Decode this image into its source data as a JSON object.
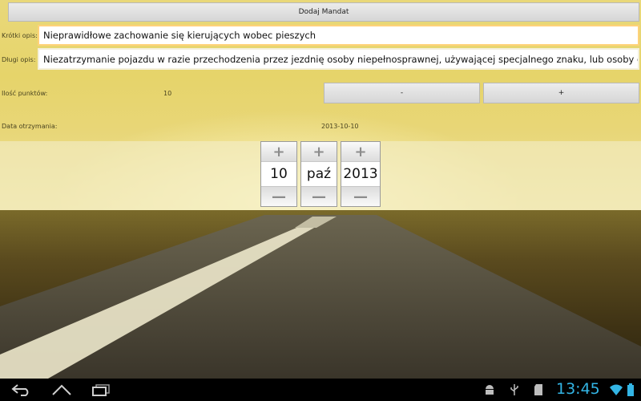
{
  "header": {
    "add_ticket_label": "Dodaj Mandat"
  },
  "form": {
    "short_desc_label": "Krótki opis:",
    "short_desc_value": "Nieprawidłowe zachowanie się kierujących wobec pieszych",
    "long_desc_label": "Długi opis:",
    "long_desc_value": "Niezatrzymanie pojazdu w razie przechodzenia przez jezdnię osoby niepełnosprawnej, używającej specjalnego znaku, lub osoby o widocznej ograniczonej zdolności poruszania się",
    "points_label": "Ilość punktów:",
    "points_value": "10",
    "minus_label": "-",
    "plus_label": "+",
    "date_label": "Data otrzymania:",
    "date_value": "2013-10-10"
  },
  "date_picker": {
    "day": "10",
    "month": "paź",
    "year": "2013",
    "increment_symbol": "+",
    "decrement_symbol": "—"
  },
  "system_bar": {
    "time": "13:45",
    "clock_color": "#33b5e5",
    "icons": [
      "back-icon",
      "home-icon",
      "recent-apps-icon",
      "android-debug-icon",
      "usb-icon",
      "sd-card-icon",
      "wifi-icon",
      "battery-icon"
    ]
  },
  "colors": {
    "field_border": "#ffd27a",
    "bar_background": "#000000"
  }
}
